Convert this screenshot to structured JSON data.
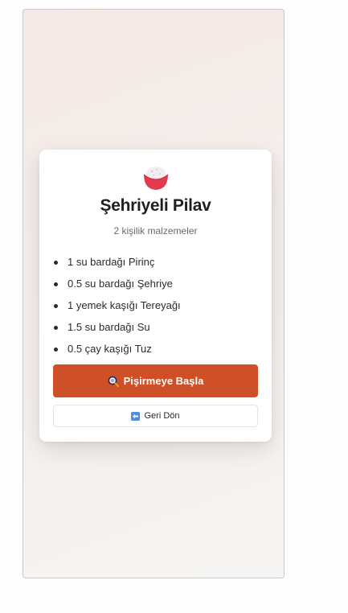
{
  "recipe": {
    "title": "Şehriyeli Pilav",
    "subtitle": "2 kişilik malzemeler",
    "icon": "rice-bowl-icon",
    "ingredients": [
      "1 su bardağı Pirinç",
      "0.5 su bardağı Şehriye",
      "1 yemek kaşığı Tereyağı",
      "1.5 su bardağı Su",
      "0.5 çay kaşığı Tuz"
    ]
  },
  "actions": {
    "start_label": "Pişirmeye Başla",
    "start_icon": "magnifier-icon",
    "back_label": "Geri Dön",
    "back_icon": "left-arrow-icon"
  },
  "colors": {
    "accent": "#cf4f26",
    "bowl": "#e23a4e"
  }
}
